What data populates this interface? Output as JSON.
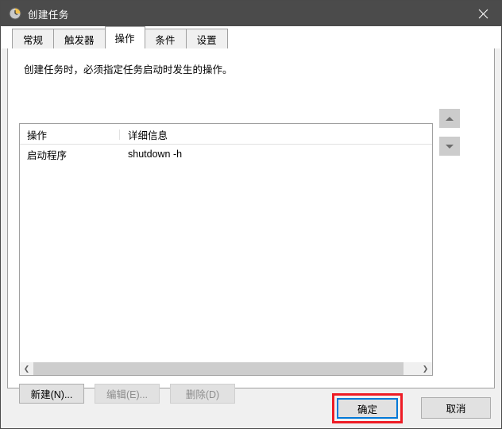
{
  "window": {
    "title": "创建任务",
    "icon": "clock-icon",
    "close_label": "×",
    "accent_blue": "#0078d7",
    "annotation_red": "#ee1c25",
    "titlebar_bg": "#4b4b4b"
  },
  "tabs": [
    {
      "label": "常规",
      "name": "tab-general",
      "active": false
    },
    {
      "label": "触发器",
      "name": "tab-triggers",
      "active": false
    },
    {
      "label": "操作",
      "name": "tab-actions",
      "active": true
    },
    {
      "label": "条件",
      "name": "tab-conditions",
      "active": false
    },
    {
      "label": "设置",
      "name": "tab-settings",
      "active": false
    }
  ],
  "panel": {
    "description": "创建任务时，必须指定任务启动时发生的操作。"
  },
  "list": {
    "columns": [
      "操作",
      "详细信息"
    ],
    "rows": [
      {
        "action": "启动程序",
        "detail": "shutdown -h"
      }
    ],
    "scrollbar": {
      "left_arrow": "❮",
      "right_arrow": "❯"
    }
  },
  "move_buttons": [
    {
      "name": "move-up-button",
      "glyph": "▲"
    },
    {
      "name": "move-down-button",
      "glyph": "▼"
    }
  ],
  "action_buttons": [
    {
      "label": "新建(N)...",
      "name": "new-button",
      "disabled": false
    },
    {
      "label": "编辑(E)...",
      "name": "edit-button",
      "disabled": true
    },
    {
      "label": "删除(D)",
      "name": "delete-button",
      "disabled": true
    }
  ],
  "footer": {
    "ok_label": "确定",
    "cancel_label": "取消"
  }
}
